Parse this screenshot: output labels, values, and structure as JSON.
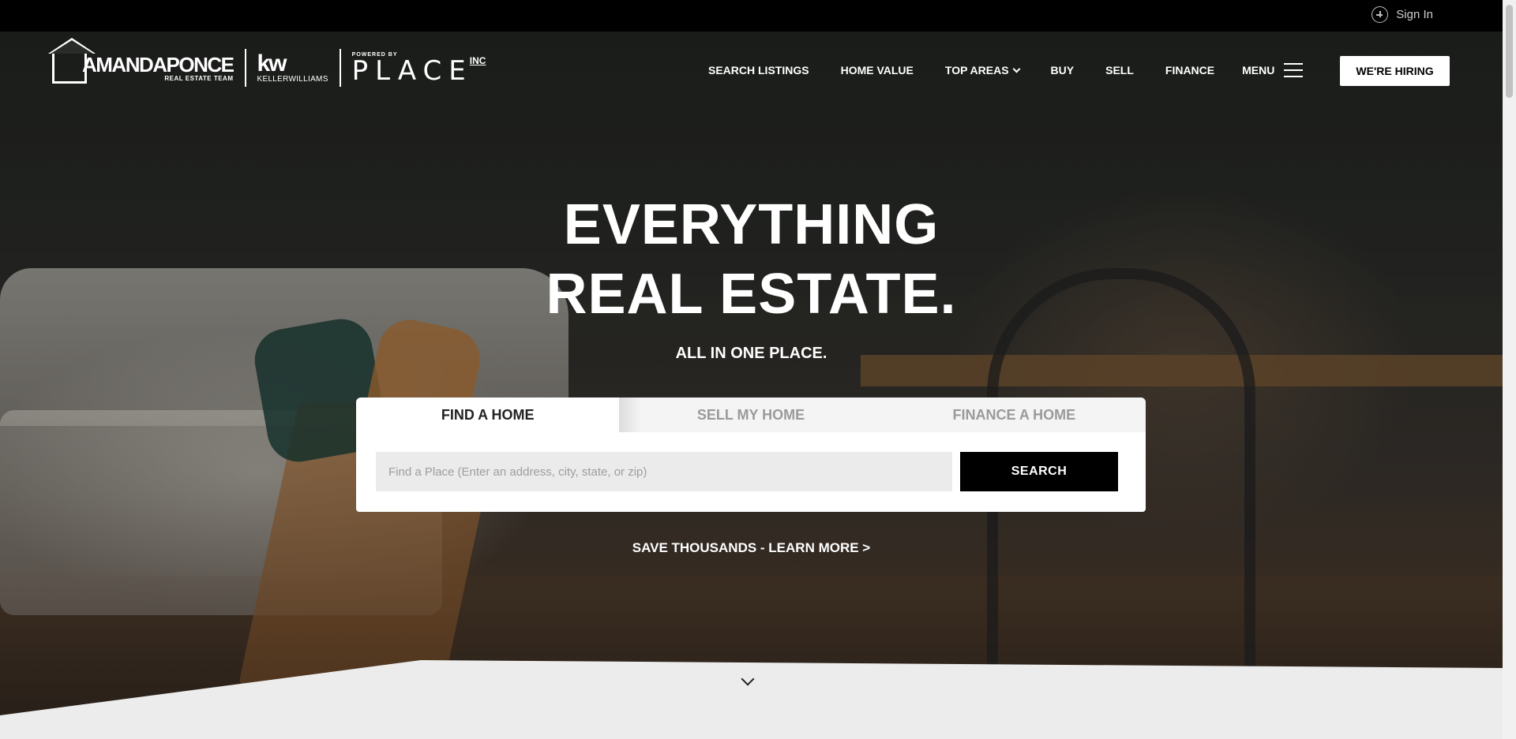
{
  "topbar": {
    "signin_label": "Sign In"
  },
  "logo": {
    "brand_name": "AMANDAPONCE",
    "brand_sub": "REAL ESTATE TEAM",
    "kw_mark": "kw",
    "kw_name": "KELLERWILLIAMS",
    "powered_by": "POWERED BY",
    "place": "PLACE",
    "inc": "INC"
  },
  "nav": {
    "items": [
      {
        "label": "SEARCH LISTINGS"
      },
      {
        "label": "HOME VALUE"
      },
      {
        "label": "TOP AREAS"
      },
      {
        "label": "BUY"
      },
      {
        "label": "SELL"
      },
      {
        "label": "FINANCE"
      }
    ],
    "menu_label": "MENU",
    "hiring_label": "WE'RE HIRING"
  },
  "hero": {
    "headline_line1": "EVERYTHING",
    "headline_line2": "REAL ESTATE.",
    "tagline": "ALL IN ONE PLACE."
  },
  "search": {
    "tabs": [
      {
        "label": "FIND A HOME",
        "active": true
      },
      {
        "label": "SELL MY HOME",
        "active": false
      },
      {
        "label": "FINANCE A HOME",
        "active": false
      }
    ],
    "placeholder": "Find a Place (Enter an address, city, state, or zip)",
    "value": "",
    "button_label": "SEARCH"
  },
  "cta": {
    "save_label": "SAVE THOUSANDS - LEARN MORE >"
  },
  "colors": {
    "accent": "#000000",
    "topbar": "#000000",
    "text_light": "#ffffff"
  },
  "icons": {
    "signin": "plus-circle-icon",
    "menu": "hamburger-icon",
    "dropdown": "chevron-down-icon",
    "scroll": "chevron-down-icon"
  }
}
